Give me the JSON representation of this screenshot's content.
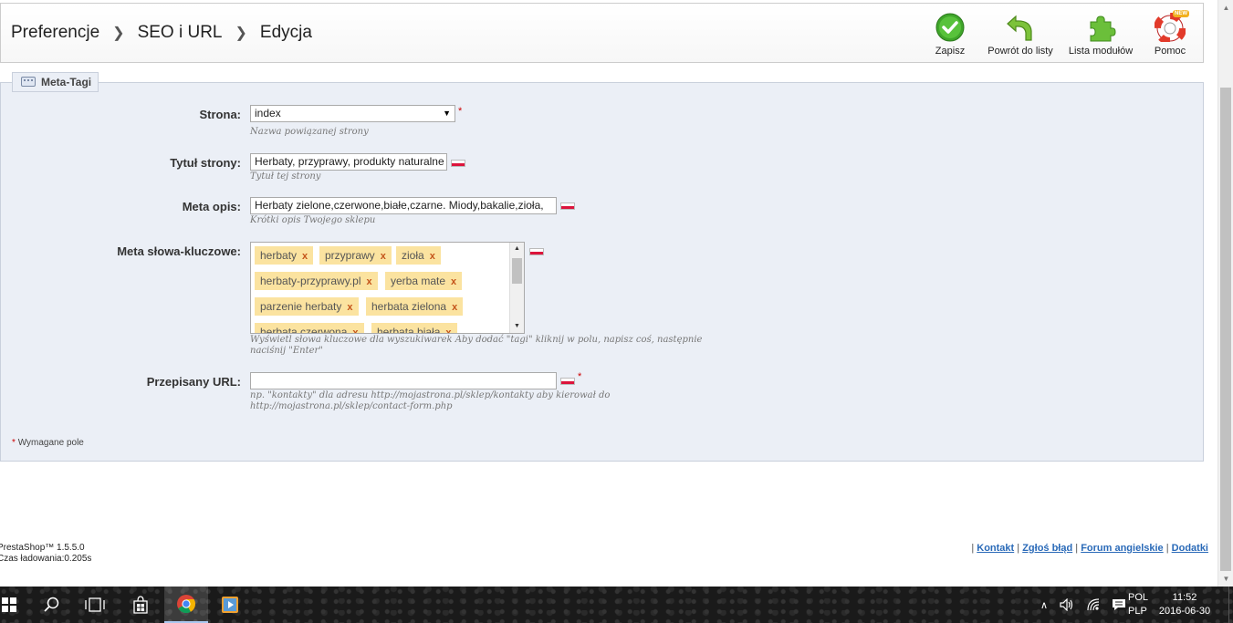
{
  "breadcrumb": [
    "Preferencje",
    "SEO i URL",
    "Edycja"
  ],
  "toolbar": {
    "save": "Zapisz",
    "back": "Powrót do listy",
    "modules": "Lista modułów",
    "help": "Pomoc",
    "help_badge": "NEW"
  },
  "fieldset": {
    "legend": "Meta-Tagi",
    "page": {
      "label": "Strona:",
      "value": "index",
      "hint": "Nazwa powiązanej strony"
    },
    "title": {
      "label": "Tytuł strony:",
      "value": "Herbaty, przyprawy, produkty naturalne",
      "hint": "Tytuł tej strony"
    },
    "description": {
      "label": "Meta opis:",
      "value": "Herbaty zielone,czerwone,białe,czarne. Miody,bakalie,zioła,",
      "hint": "Krótki opis Twojego sklepu"
    },
    "keywords": {
      "label": "Meta słowa-kluczowe:",
      "tags": [
        "herbaty",
        "przyprawy",
        "zioła",
        "herbaty-przyprawy.pl",
        "yerba mate",
        "parzenie herbaty",
        "herbata zielona",
        "herbata czerwona",
        "herbata biała"
      ],
      "tag_remove": "x",
      "hint": "Wyświetl słowa kluczowe dla wyszukiwarek Aby dodać \"tagi\" kliknij w polu, napisz coś, następnie naciśnij \"Enter\""
    },
    "url": {
      "label": "Przepisany URL:",
      "value": "",
      "hint_line1": "np. \"kontakty\" dla adresu http://mojastrona.pl/sklep/kontakty aby kierował do",
      "hint_line2": "http://mojastrona.pl/sklep/contact-form.php"
    },
    "required_mark": "*",
    "required_note": "Wymagane pole"
  },
  "footer": {
    "version": "PrestaShop™ 1.5.5.0",
    "load_time": "Czas ładowania:0.205s",
    "links": [
      "Kontakt",
      "Zgłoś błąd",
      "Forum angielskie",
      "Dodatki"
    ],
    "sep": "|"
  },
  "taskbar": {
    "lang_line1": "POL",
    "lang_line2": "PLP",
    "time": "11:52",
    "date": "2016-06-30"
  },
  "colors": {
    "accent_link": "#2a6ab8",
    "fieldset_bg": "#ebeff6",
    "tag_bg": "#fbe3a0",
    "required": "#cc0000"
  }
}
